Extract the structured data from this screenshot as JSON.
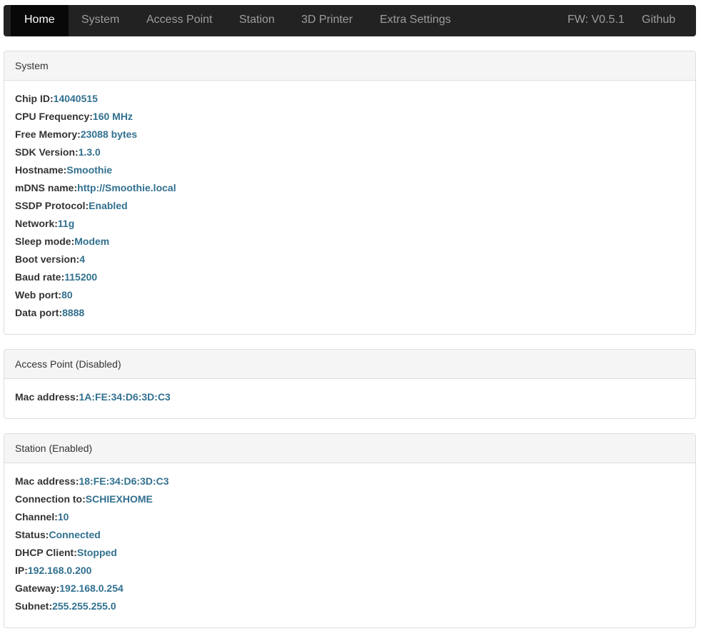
{
  "navbar": {
    "items": [
      {
        "label": "Home",
        "active": true
      },
      {
        "label": "System"
      },
      {
        "label": "Access Point"
      },
      {
        "label": "Station"
      },
      {
        "label": "3D Printer"
      },
      {
        "label": "Extra Settings"
      }
    ],
    "fw": "FW: V0.5.1",
    "github": "Github"
  },
  "colors": {
    "navbar_bg": "#222222",
    "value_text": "#31708f",
    "panel_heading_bg": "#f5f5f5"
  },
  "system": {
    "title": "System",
    "rows": [
      {
        "label": "Chip ID:",
        "value": "14040515"
      },
      {
        "label": "CPU Frequency:",
        "value": "160 MHz"
      },
      {
        "label": "Free Memory:",
        "value": "23088 bytes"
      },
      {
        "label": "SDK Version:",
        "value": "1.3.0"
      },
      {
        "label": "Hostname:",
        "value": "Smoothie"
      },
      {
        "label": "mDNS name:",
        "value": "http://Smoothie.local"
      },
      {
        "label": "SSDP Protocol:",
        "value": "Enabled"
      },
      {
        "label": "Network:",
        "value": "11g"
      },
      {
        "label": "Sleep mode:",
        "value": "Modem"
      },
      {
        "label": "Boot version:",
        "value": "4"
      },
      {
        "label": "Baud rate:",
        "value": "115200"
      },
      {
        "label": "Web port:",
        "value": "80"
      },
      {
        "label": "Data port:",
        "value": "8888"
      }
    ]
  },
  "access_point": {
    "title": "Access Point (Disabled)",
    "rows": [
      {
        "label": "Mac address:",
        "value": "1A:FE:34:D6:3D:C3"
      }
    ]
  },
  "station": {
    "title": "Station (Enabled)",
    "rows": [
      {
        "label": "Mac address:",
        "value": "18:FE:34:D6:3D:C3"
      },
      {
        "label": "Connection to:",
        "value": "SCHIEXHOME"
      },
      {
        "label": "Channel:",
        "value": "10"
      },
      {
        "label": "Status:",
        "value": "Connected"
      },
      {
        "label": "DHCP Client:",
        "value": "Stopped"
      },
      {
        "label": "IP:",
        "value": "192.168.0.200"
      },
      {
        "label": "Gateway:",
        "value": "192.168.0.254"
      },
      {
        "label": "Subnet:",
        "value": "255.255.255.0"
      }
    ]
  }
}
